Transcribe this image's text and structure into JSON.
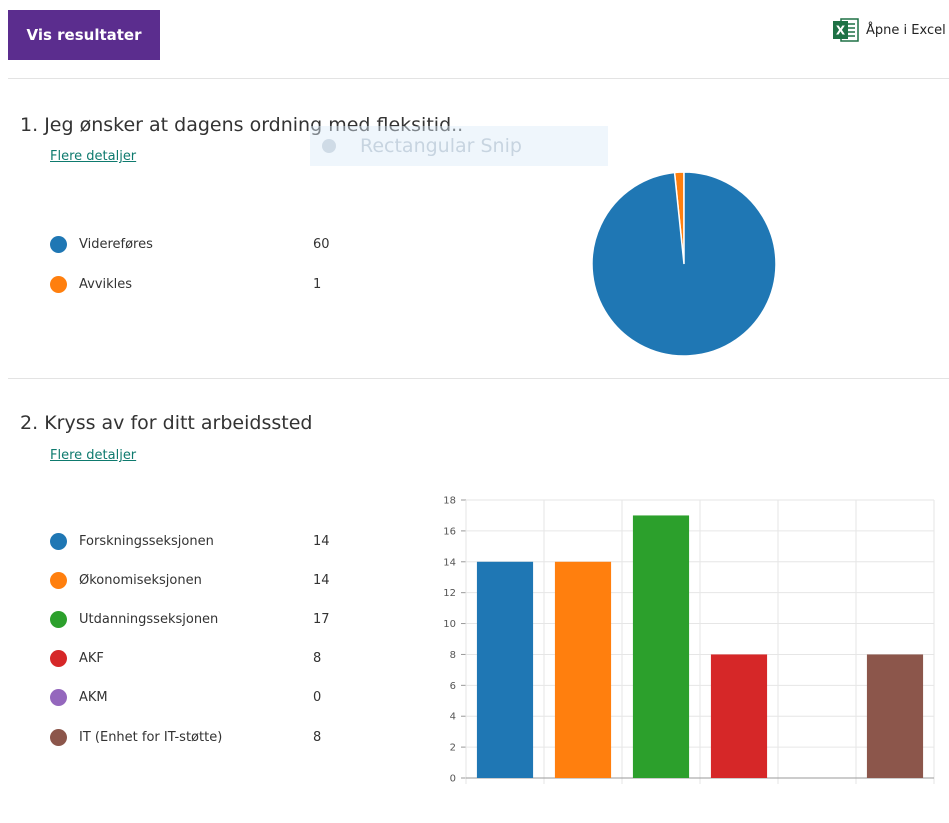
{
  "header": {
    "results_button": "Vis resultater",
    "excel_link": "Åpne i Excel",
    "excel_icon": "excel-icon"
  },
  "overlay": {
    "label": "Rectangular Snip"
  },
  "questions": [
    {
      "number": "1.",
      "title": "Jeg ønsker at dagens ordning med fleksitid..",
      "details_link": "Flere detaljer",
      "options": [
        {
          "label": "Videreføres",
          "count": "60",
          "color": "#1f77b4"
        },
        {
          "label": "Avvikles",
          "count": "1",
          "color": "#ff7f0e"
        }
      ]
    },
    {
      "number": "2.",
      "title": "Kryss av for ditt arbeidssted",
      "details_link": "Flere detaljer",
      "options": [
        {
          "label": "Forskningsseksjonen",
          "count": "14",
          "color": "#1f77b4"
        },
        {
          "label": "Økonomiseksjonen",
          "count": "14",
          "color": "#ff7f0e"
        },
        {
          "label": "Utdanningsseksjonen",
          "count": "17",
          "color": "#2ca02c"
        },
        {
          "label": "AKF",
          "count": "8",
          "color": "#d62728"
        },
        {
          "label": "AKM",
          "count": "0",
          "color": "#9467bd"
        },
        {
          "label": "IT (Enhet for IT-støtte)",
          "count": "8",
          "color": "#8c564b"
        }
      ]
    }
  ],
  "chart_data": [
    {
      "type": "pie",
      "title": "",
      "categories": [
        "Videreføres",
        "Avvikles"
      ],
      "values": [
        60,
        1
      ],
      "colors": [
        "#1f77b4",
        "#ff7f0e"
      ]
    },
    {
      "type": "bar",
      "title": "",
      "xlabel": "",
      "ylabel": "",
      "categories": [
        "Forskningsseksjonen",
        "Økonomiseksjonen",
        "Utdanningsseksjonen",
        "AKF",
        "AKM",
        "IT (Enhet for IT-støtte)"
      ],
      "values": [
        14,
        14,
        17,
        8,
        0,
        8
      ],
      "colors": [
        "#1f77b4",
        "#ff7f0e",
        "#2ca02c",
        "#d62728",
        "#9467bd",
        "#8c564b"
      ],
      "ylim": [
        0,
        18
      ],
      "yticks": [
        "0",
        "2",
        "4",
        "6",
        "8",
        "10",
        "12",
        "14",
        "16",
        "18"
      ],
      "grid": true
    }
  ]
}
